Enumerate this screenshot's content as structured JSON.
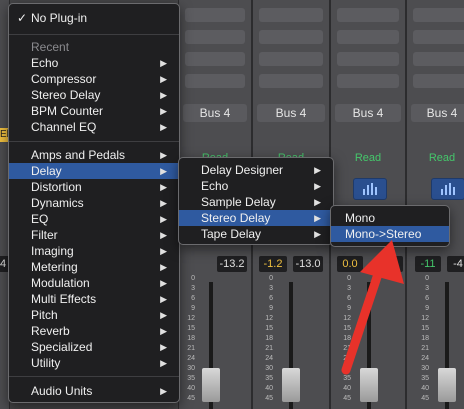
{
  "mixer": {
    "bus_labels": [
      "Bus 4",
      "Bus 4",
      "Bus 4",
      "Bus 4"
    ],
    "read_labels": [
      "Read",
      "Read",
      "Read",
      "Read"
    ],
    "values": [
      "-13.2",
      "-1.2",
      "-13.0",
      "0.0",
      "4",
      "-11",
      "-4"
    ],
    "left_values": [
      "El",
      "4"
    ],
    "scale": [
      "0",
      "3",
      "6",
      "9",
      "12",
      "15",
      "18",
      "21",
      "24",
      "30",
      "35",
      "40",
      "45"
    ]
  },
  "main_menu": {
    "no_plugin": "No Plug-in",
    "check": "✓",
    "recent_header": "Recent",
    "recent": [
      "Echo",
      "Compressor",
      "Stereo Delay",
      "BPM Counter",
      "Channel EQ"
    ],
    "categories": [
      "Amps and Pedals",
      "Delay",
      "Distortion",
      "Dynamics",
      "EQ",
      "Filter",
      "Imaging",
      "Metering",
      "Modulation",
      "Multi Effects",
      "Pitch",
      "Reverb",
      "Specialized",
      "Utility"
    ],
    "audio_units": "Audio Units"
  },
  "delay_menu": {
    "items": [
      "Delay Designer",
      "Echo",
      "Sample Delay",
      "Stereo Delay",
      "Tape Delay"
    ]
  },
  "stereo_delay_menu": {
    "items": [
      "Mono",
      "Mono->Stereo"
    ]
  },
  "annotation": {
    "color": "#e8322a"
  }
}
